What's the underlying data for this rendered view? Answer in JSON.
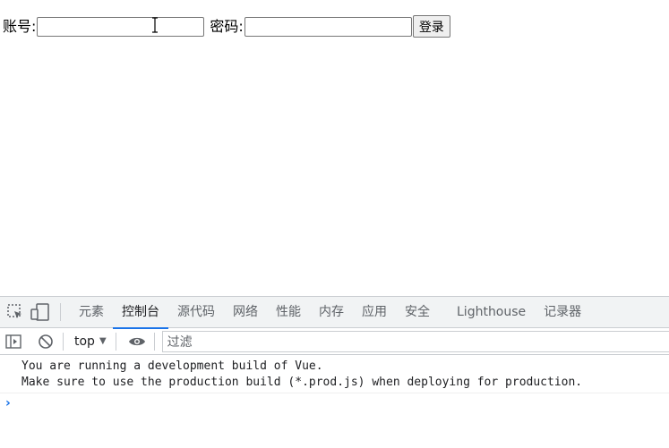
{
  "login": {
    "account_label": "账号:",
    "password_label": "密码:",
    "account_value": "",
    "password_value": "",
    "submit_label": "登录"
  },
  "devtools": {
    "tabs": [
      {
        "label": "元素",
        "active": false
      },
      {
        "label": "控制台",
        "active": true
      },
      {
        "label": "源代码",
        "active": false
      },
      {
        "label": "网络",
        "active": false
      },
      {
        "label": "性能",
        "active": false
      },
      {
        "label": "内存",
        "active": false
      },
      {
        "label": "应用",
        "active": false
      },
      {
        "label": "安全",
        "active": false
      },
      {
        "label": "Lighthouse",
        "active": false
      },
      {
        "label": "记录器",
        "active": false
      }
    ],
    "toolbar": {
      "context": "top",
      "filter_placeholder": "过滤"
    },
    "console_messages": [
      "You are running a development build of Vue.",
      "Make sure to use the production build (*.prod.js) when deploying for production."
    ],
    "accent_color": "#1a73e8"
  }
}
